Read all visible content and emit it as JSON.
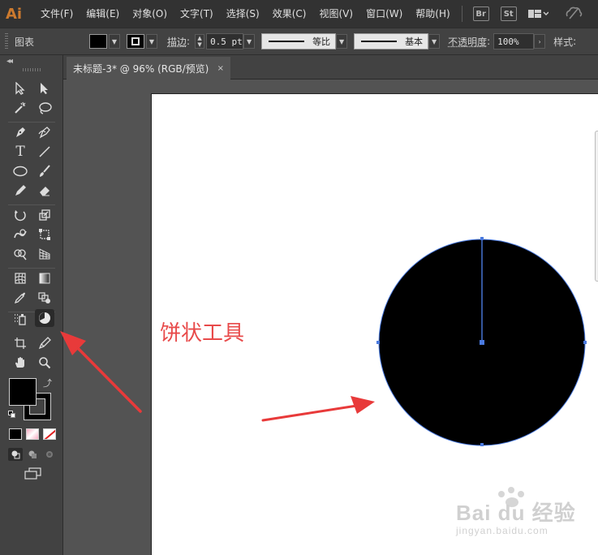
{
  "app": {
    "logo": "Ai",
    "menu": [
      "文件(F)",
      "编辑(E)",
      "对象(O)",
      "文字(T)",
      "选择(S)",
      "效果(C)",
      "视图(V)",
      "窗口(W)",
      "帮助(H)"
    ],
    "bridge_label": "Br",
    "stock_label": "St",
    "workspace_icon": "workspace-switcher-icon",
    "sync_icon": "sync-settings-icon"
  },
  "control_bar": {
    "selection_label": "图表",
    "stroke_label": "描边",
    "stroke_weight": "0.5 pt",
    "profile_label": "等比",
    "brush_label": "基本",
    "opacity_label": "不透明度",
    "opacity_value": "100%",
    "style_label": "样式"
  },
  "document": {
    "tab_title": "未标题-3* @ 96% (RGB/预览)",
    "close_glyph": "×"
  },
  "tools": {
    "active_tool": "pie-graph-tool",
    "fill_color": "#000000",
    "stroke_color": "#000000"
  },
  "artwork": {
    "annotation": "饼状工具",
    "annotation_color": "#e84a4a",
    "pie_color": "#000000",
    "selection_color": "#4a7ae0",
    "arrow_color": "#e83a3a"
  },
  "watermark": {
    "line1": "Bai du 经验",
    "line2": "jingyan.baidu.com"
  }
}
